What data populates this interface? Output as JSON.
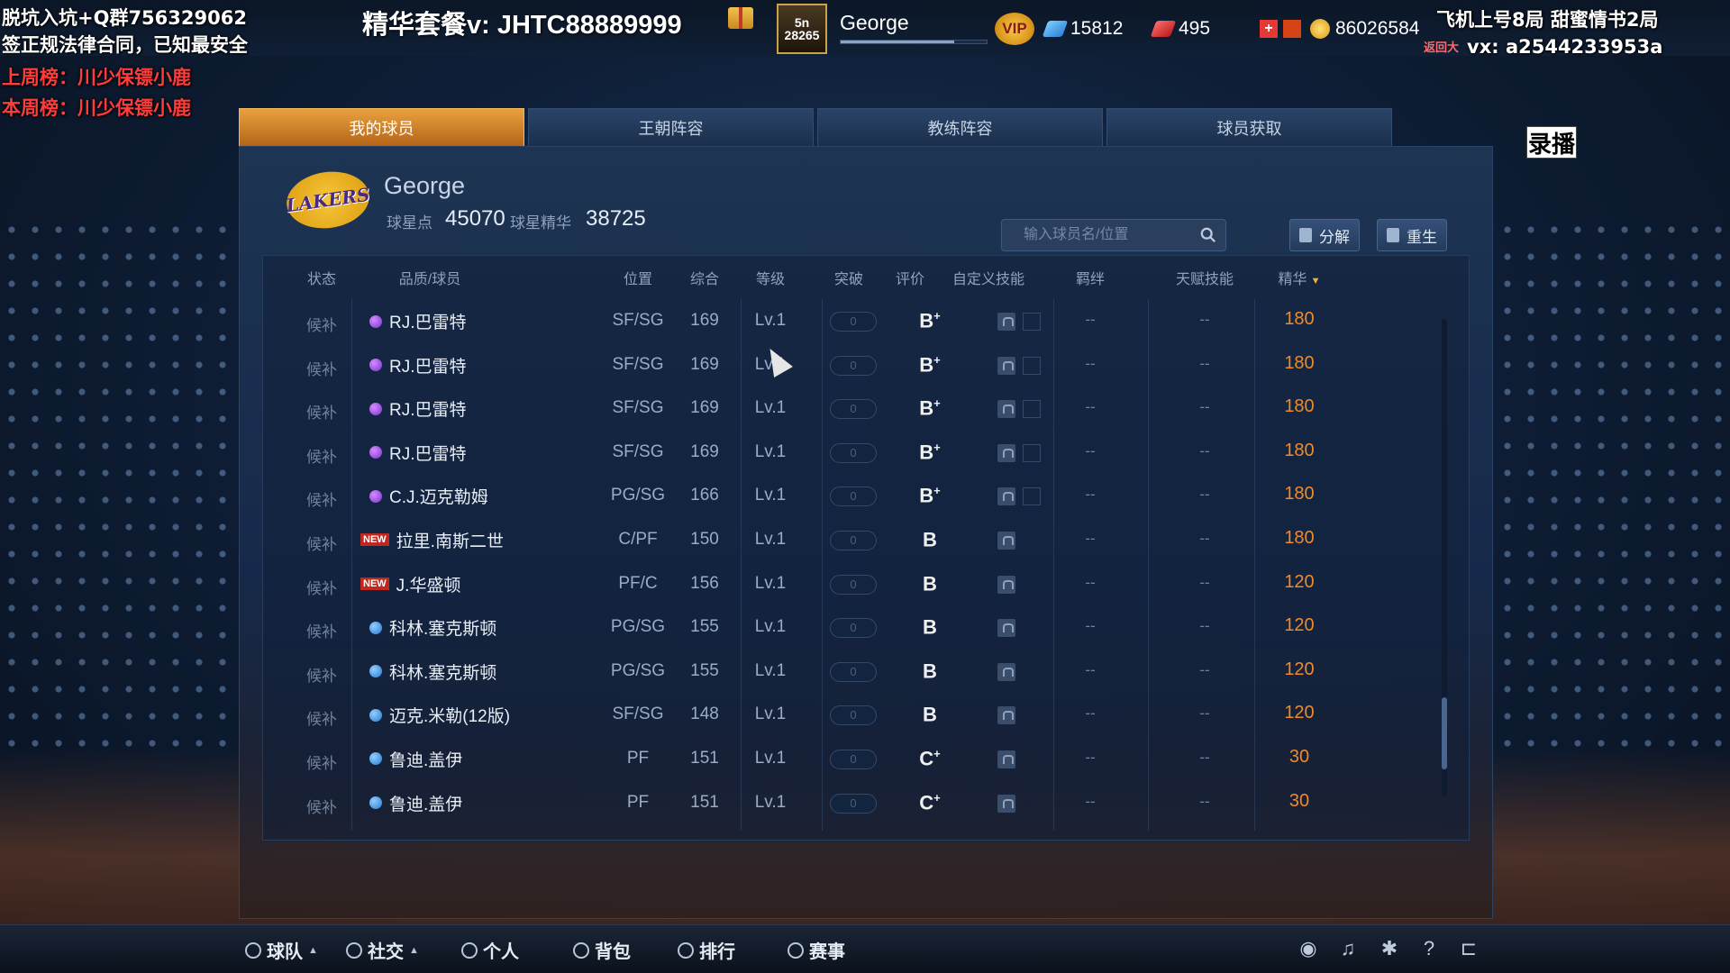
{
  "overlay": {
    "line1": "脱坑入坑+Q群756329062",
    "line2": "签正规法律合同，已知最安全",
    "line3": "上周榜：川少保镖小鹿",
    "line4": "本周榜：川少保镖小鹿",
    "right1": "飞机上号8局   甜蜜情书2局",
    "right2": "vx: a2544233953a",
    "back_label": "返回大",
    "record_label": "录播"
  },
  "topbar": {
    "promo": "精华套餐v: JHTC88889999",
    "level_badge": "5n 28265",
    "username": "George",
    "xp_progress": 0.78,
    "vip_label": "VIP",
    "diamonds": "15812",
    "tickets": "495",
    "coins": "86026584"
  },
  "tabs": [
    {
      "label": "我的球员",
      "active": true
    },
    {
      "label": "王朝阵容",
      "active": false
    },
    {
      "label": "教练阵容",
      "active": false
    },
    {
      "label": "球员获取",
      "active": false
    }
  ],
  "team": {
    "logo_text": "LAKERS",
    "name": "George",
    "star_points_label": "球星点",
    "star_points": "45070",
    "essence_label": "球星精华",
    "essence": "38725"
  },
  "search": {
    "placeholder": "输入球员名/位置"
  },
  "buttons": {
    "decompose": "分解",
    "rebirth": "重生"
  },
  "columns": [
    "状态",
    "品质/球员",
    "位置",
    "综合",
    "等级",
    "突破",
    "评价",
    "自定义技能",
    "羁绊",
    "天赋技能",
    "精华"
  ],
  "players": [
    {
      "status": "候补",
      "quality": "purple",
      "new": false,
      "name": "RJ.巴雷特",
      "pos": "SF/SG",
      "ovr": "169",
      "lvl": "Lv.1",
      "breakout": "0",
      "grade": "B",
      "plus": "+",
      "slot": true,
      "bond": "--",
      "talent": "--",
      "essence": "180"
    },
    {
      "status": "候补",
      "quality": "purple",
      "new": false,
      "name": "RJ.巴雷特",
      "pos": "SF/SG",
      "ovr": "169",
      "lvl": "Lv.1",
      "breakout": "0",
      "grade": "B",
      "plus": "+",
      "slot": true,
      "bond": "--",
      "talent": "--",
      "essence": "180"
    },
    {
      "status": "候补",
      "quality": "purple",
      "new": false,
      "name": "RJ.巴雷特",
      "pos": "SF/SG",
      "ovr": "169",
      "lvl": "Lv.1",
      "breakout": "0",
      "grade": "B",
      "plus": "+",
      "slot": true,
      "bond": "--",
      "talent": "--",
      "essence": "180"
    },
    {
      "status": "候补",
      "quality": "purple",
      "new": false,
      "name": "RJ.巴雷特",
      "pos": "SF/SG",
      "ovr": "169",
      "lvl": "Lv.1",
      "breakout": "0",
      "grade": "B",
      "plus": "+",
      "slot": true,
      "bond": "--",
      "talent": "--",
      "essence": "180"
    },
    {
      "status": "候补",
      "quality": "purple",
      "new": false,
      "name": "C.J.迈克勒姆",
      "pos": "PG/SG",
      "ovr": "166",
      "lvl": "Lv.1",
      "breakout": "0",
      "grade": "B",
      "plus": "+",
      "slot": true,
      "bond": "--",
      "talent": "--",
      "essence": "180"
    },
    {
      "status": "候补",
      "quality": "none",
      "new": true,
      "name": "拉里.南斯二世",
      "pos": "C/PF",
      "ovr": "150",
      "lvl": "Lv.1",
      "breakout": "0",
      "grade": "B",
      "plus": "",
      "slot": false,
      "bond": "--",
      "talent": "--",
      "essence": "180"
    },
    {
      "status": "候补",
      "quality": "none",
      "new": true,
      "name": "J.华盛顿",
      "pos": "PF/C",
      "ovr": "156",
      "lvl": "Lv.1",
      "breakout": "0",
      "grade": "B",
      "plus": "",
      "slot": false,
      "bond": "--",
      "talent": "--",
      "essence": "120"
    },
    {
      "status": "候补",
      "quality": "blue",
      "new": false,
      "name": "科林.塞克斯顿",
      "pos": "PG/SG",
      "ovr": "155",
      "lvl": "Lv.1",
      "breakout": "0",
      "grade": "B",
      "plus": "",
      "slot": false,
      "bond": "--",
      "talent": "--",
      "essence": "120"
    },
    {
      "status": "候补",
      "quality": "blue",
      "new": false,
      "name": "科林.塞克斯顿",
      "pos": "PG/SG",
      "ovr": "155",
      "lvl": "Lv.1",
      "breakout": "0",
      "grade": "B",
      "plus": "",
      "slot": false,
      "bond": "--",
      "talent": "--",
      "essence": "120"
    },
    {
      "status": "候补",
      "quality": "blue",
      "new": false,
      "name": "迈克.米勒(12版)",
      "pos": "SF/SG",
      "ovr": "148",
      "lvl": "Lv.1",
      "breakout": "0",
      "grade": "B",
      "plus": "",
      "slot": false,
      "bond": "--",
      "talent": "--",
      "essence": "120"
    },
    {
      "status": "候补",
      "quality": "blue",
      "new": false,
      "name": "鲁迪.盖伊",
      "pos": "PF",
      "ovr": "151",
      "lvl": "Lv.1",
      "breakout": "0",
      "grade": "C",
      "plus": "+",
      "slot": false,
      "bond": "--",
      "talent": "--",
      "essence": "30"
    },
    {
      "status": "候补",
      "quality": "blue",
      "new": false,
      "name": "鲁迪.盖伊",
      "pos": "PF",
      "ovr": "151",
      "lvl": "Lv.1",
      "breakout": "0",
      "grade": "C",
      "plus": "+",
      "slot": false,
      "bond": "--",
      "talent": "--",
      "essence": "30"
    }
  ],
  "bottom_nav": [
    {
      "label": "球队",
      "icon": "team-icon",
      "caret": true
    },
    {
      "label": "社交",
      "icon": "social-icon",
      "caret": true
    },
    {
      "label": "个人",
      "icon": "person-icon",
      "caret": false
    },
    {
      "label": "背包",
      "icon": "bag-icon",
      "caret": false
    },
    {
      "label": "排行",
      "icon": "rank-icon",
      "caret": false
    },
    {
      "label": "赛事",
      "icon": "trophy-icon",
      "caret": false
    }
  ],
  "colors": {
    "accent_orange": "#f08a28",
    "tab_active": "#e8a13e",
    "panel": "#1d3452"
  }
}
